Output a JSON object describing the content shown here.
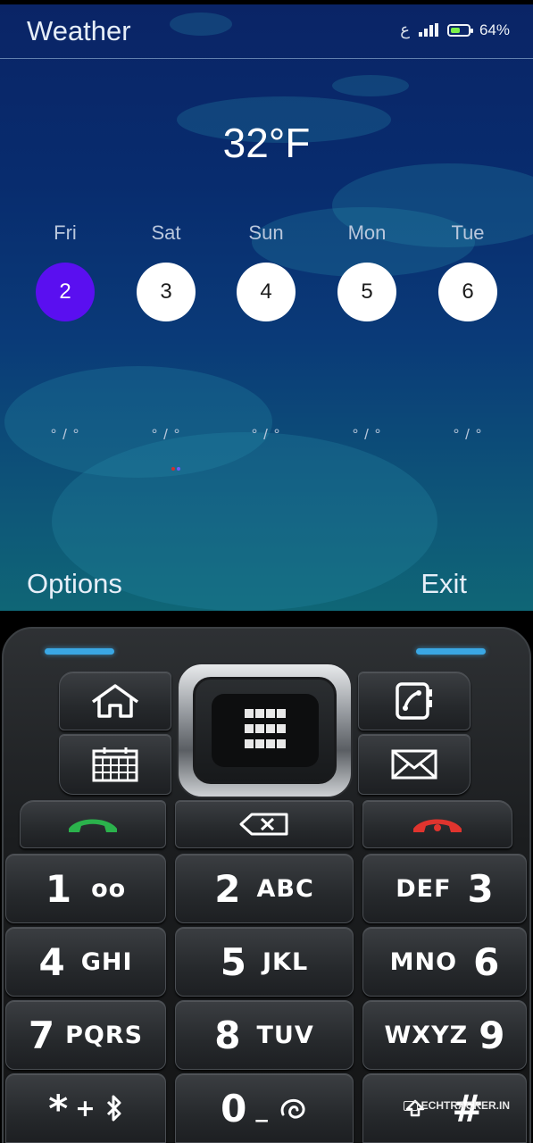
{
  "status_bar": {
    "network_label": "ع",
    "battery_percent": "64%",
    "battery_level": 0.64,
    "battery_color": "#7cf04a"
  },
  "app": {
    "title": "Weather",
    "current_temp": "32°F"
  },
  "forecast": [
    {
      "day": "Fri",
      "date": "2",
      "range": "° / °",
      "selected": true
    },
    {
      "day": "Sat",
      "date": "3",
      "range": "° / °",
      "selected": false
    },
    {
      "day": "Sun",
      "date": "4",
      "range": "° / °",
      "selected": false
    },
    {
      "day": "Mon",
      "date": "5",
      "range": "° / °",
      "selected": false
    },
    {
      "day": "Tue",
      "date": "6",
      "range": "° / °",
      "selected": false
    }
  ],
  "softkeys": {
    "left": "Options",
    "right": "Exit"
  },
  "colors": {
    "selected_date": "#5a0ff0",
    "led": "#3aa7e4",
    "call_green": "#2bb24c",
    "end_red": "#e0342e"
  },
  "keypad": {
    "keys": [
      {
        "num": "1",
        "letters": "oo"
      },
      {
        "num": "2",
        "letters": "ABC"
      },
      {
        "num": "3",
        "letters": "DEF"
      },
      {
        "num": "4",
        "letters": "GHI"
      },
      {
        "num": "5",
        "letters": "JKL"
      },
      {
        "num": "6",
        "letters": "MNO"
      },
      {
        "num": "7",
        "letters": "PQRS"
      },
      {
        "num": "8",
        "letters": "TUV"
      },
      {
        "num": "9",
        "letters": "WXYZ"
      },
      {
        "num": "*",
        "letters": "+"
      },
      {
        "num": "0",
        "letters": "_"
      },
      {
        "num": "#",
        "letters": ""
      }
    ],
    "icons": [
      "home-icon",
      "calendar-icon",
      "menu-grid-icon",
      "contacts-icon",
      "mail-icon",
      "call-icon",
      "backspace-icon",
      "end-call-icon",
      "voicemail-icon",
      "bluetooth-icon",
      "space-icon",
      "shift-icon"
    ]
  },
  "watermark": "ECHTRACKER.IN"
}
